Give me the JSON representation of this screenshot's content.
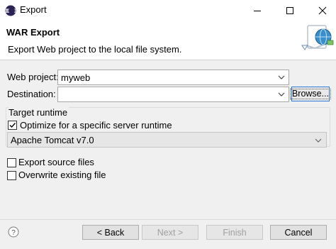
{
  "window": {
    "title": "Export"
  },
  "banner": {
    "title": "WAR Export",
    "description": "Export Web project to the local file system."
  },
  "form": {
    "web_project_label": "Web project:",
    "web_project_value": "myweb",
    "destination_label": "Destination:",
    "destination_value": "",
    "browse_label": "Browse..."
  },
  "target_runtime": {
    "group_label": "Target runtime",
    "optimize_label": "Optimize for a specific server runtime",
    "optimize_checked": true,
    "runtime_value": "Apache Tomcat v7.0"
  },
  "options": {
    "export_source_label": "Export source files",
    "export_source_checked": false,
    "overwrite_label": "Overwrite existing file",
    "overwrite_checked": false
  },
  "buttons": {
    "back": "< Back",
    "next": "Next >",
    "finish": "Finish",
    "cancel": "Cancel"
  },
  "icons": {
    "app": "eclipse-icon",
    "banner": "export-war-icon",
    "help": "help-icon"
  },
  "colors": {
    "accent": "#2b78d6"
  }
}
